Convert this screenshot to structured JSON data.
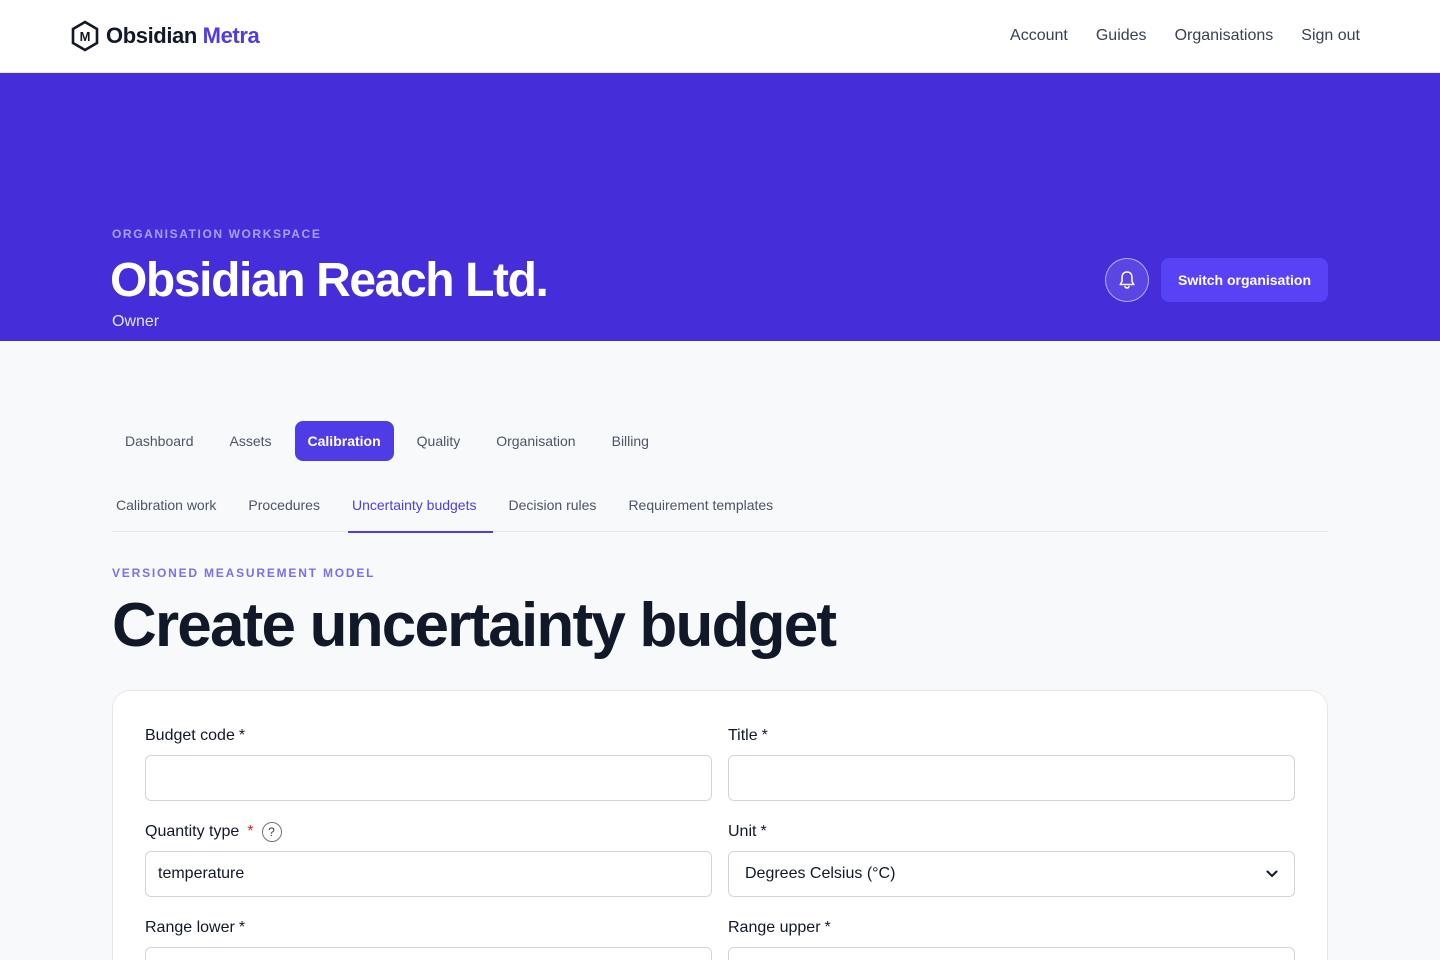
{
  "brand": {
    "name_a": "Obsidian",
    "name_b": "Metra",
    "logo_letter": "M"
  },
  "topnav": [
    "Account",
    "Guides",
    "Organisations",
    "Sign out"
  ],
  "hero": {
    "eyebrow": "ORGANISATION WORKSPACE",
    "title": "Obsidian Reach Ltd.",
    "role": "Owner",
    "switch_label": "Switch organisation",
    "bell_icon": "bell-icon"
  },
  "tabs": [
    "Dashboard",
    "Assets",
    "Calibration",
    "Quality",
    "Organisation",
    "Billing"
  ],
  "active_tab": "Calibration",
  "subtabs": [
    "Calibration work",
    "Procedures",
    "Uncertainty budgets",
    "Decision rules",
    "Requirement templates"
  ],
  "active_subtab": "Uncertainty budgets",
  "page": {
    "eyebrow": "VERSIONED MEASUREMENT MODEL",
    "title": "Create uncertainty budget"
  },
  "form": {
    "budget_code": {
      "label": "Budget code",
      "value": ""
    },
    "title": {
      "label": "Title",
      "value": ""
    },
    "quantity_type": {
      "label": "Quantity type",
      "value": "temperature",
      "help": "?"
    },
    "unit": {
      "label": "Unit",
      "value": "Degrees Celsius (°C)"
    },
    "range_lower": {
      "label": "Range lower",
      "value": ""
    },
    "range_upper": {
      "label": "Range upper",
      "value": ""
    }
  },
  "colors": {
    "accent": "#4f3ce6",
    "hero_bg": "#452ed9",
    "required_red": "#dc2626"
  }
}
